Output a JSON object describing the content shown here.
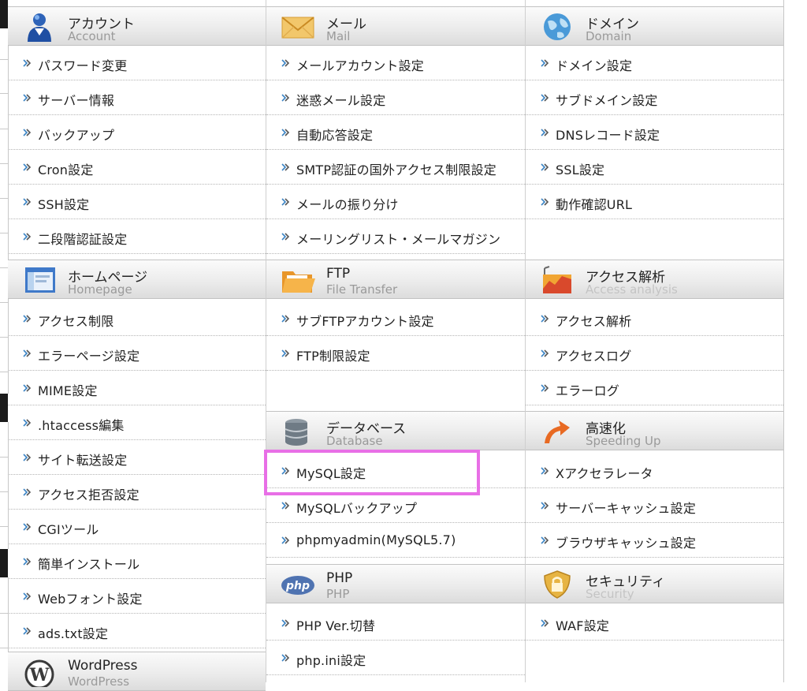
{
  "sections": {
    "account": {
      "title": "アカウント",
      "subtitle": "Account",
      "icon": "account-icon",
      "items": [
        "パスワード変更",
        "サーバー情報",
        "バックアップ",
        "Cron設定",
        "SSH設定",
        "二段階認証設定"
      ]
    },
    "mail": {
      "title": "メール",
      "subtitle": "Mail",
      "icon": "mail-icon",
      "items": [
        "メールアカウント設定",
        "迷惑メール設定",
        "自動応答設定",
        "SMTP認証の国外アクセス制限設定",
        "メールの振り分け",
        "メーリングリスト・メールマガジン"
      ]
    },
    "domain": {
      "title": "ドメイン",
      "subtitle": "Domain",
      "icon": "globe-icon",
      "items": [
        "ドメイン設定",
        "サブドメイン設定",
        "DNSレコード設定",
        "SSL設定",
        "動作確認URL"
      ]
    },
    "homepage": {
      "title": "ホームページ",
      "subtitle": "Homepage",
      "icon": "browser-window-icon",
      "items": [
        "アクセス制限",
        "エラーページ設定",
        "MIME設定",
        ".htaccess編集",
        "サイト転送設定",
        "アクセス拒否設定",
        "CGIツール",
        "簡単インストール",
        "Webフォント設定",
        "ads.txt設定"
      ]
    },
    "ftp": {
      "title": "FTP",
      "subtitle": "File Transfer",
      "icon": "folder-icon",
      "items": [
        "サブFTPアカウント設定",
        "FTP制限設定"
      ]
    },
    "access_analysis": {
      "title": "アクセス解析",
      "subtitle": "Access analysis",
      "icon": "chart-icon",
      "items": [
        "アクセス解析",
        "アクセスログ",
        "エラーログ"
      ]
    },
    "database": {
      "title": "データベース",
      "subtitle": "Database",
      "icon": "database-icon",
      "items": [
        "MySQL設定",
        "MySQLバックアップ",
        "phpmyadmin(MySQL5.7)"
      ]
    },
    "speed": {
      "title": "高速化",
      "subtitle": "Speeding Up",
      "icon": "speed-arrow-icon",
      "items": [
        "Xアクセラレータ",
        "サーバーキャッシュ設定",
        "ブラウザキャッシュ設定"
      ]
    },
    "php": {
      "title": "PHP",
      "subtitle": "PHP",
      "icon": "php-icon",
      "icon_text": "php",
      "items": [
        "PHP Ver.切替",
        "php.ini設定"
      ]
    },
    "security": {
      "title": "セキュリティ",
      "subtitle": "Security",
      "icon": "shield-lock-icon",
      "items": [
        "WAF設定"
      ]
    },
    "wordpress": {
      "title": "WordPress",
      "subtitle": "WordPress",
      "icon": "wordpress-icon"
    }
  },
  "highlighted_item": "MySQL設定",
  "colors": {
    "highlight": "#e86fe6",
    "arrow": "#3b84c4",
    "subtitle": "#9a9a9a"
  }
}
